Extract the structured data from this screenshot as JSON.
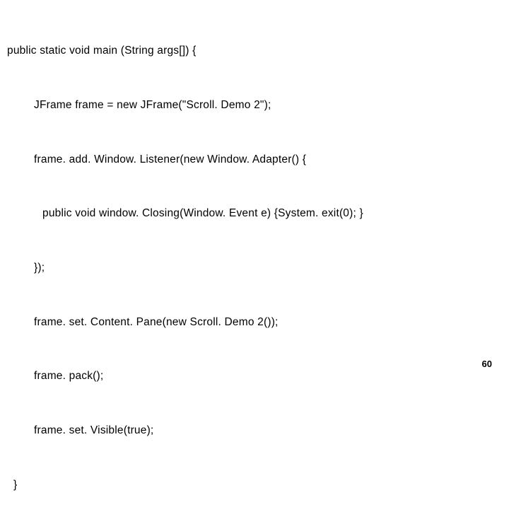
{
  "code": {
    "lines": [
      {
        "indent": 0,
        "text": "public static void main (String args[]) {"
      },
      {
        "indent": 1,
        "text": "JFrame frame = new JFrame(\"Scroll. Demo 2\");"
      },
      {
        "indent": 1,
        "text": "frame. add. Window. Listener(new Window. Adapter() {"
      },
      {
        "indent": 2,
        "text": "public void window. Closing(Window. Event e) {System. exit(0); }"
      },
      {
        "indent": 1,
        "text": "});"
      },
      {
        "indent": 1,
        "text": "frame. set. Content. Pane(new Scroll. Demo 2());"
      },
      {
        "indent": 1,
        "text": "frame. pack();"
      },
      {
        "indent": 1,
        "text": "frame. set. Visible(true);"
      },
      {
        "indent": 0,
        "text": "  }"
      }
    ]
  },
  "page_number": "60"
}
